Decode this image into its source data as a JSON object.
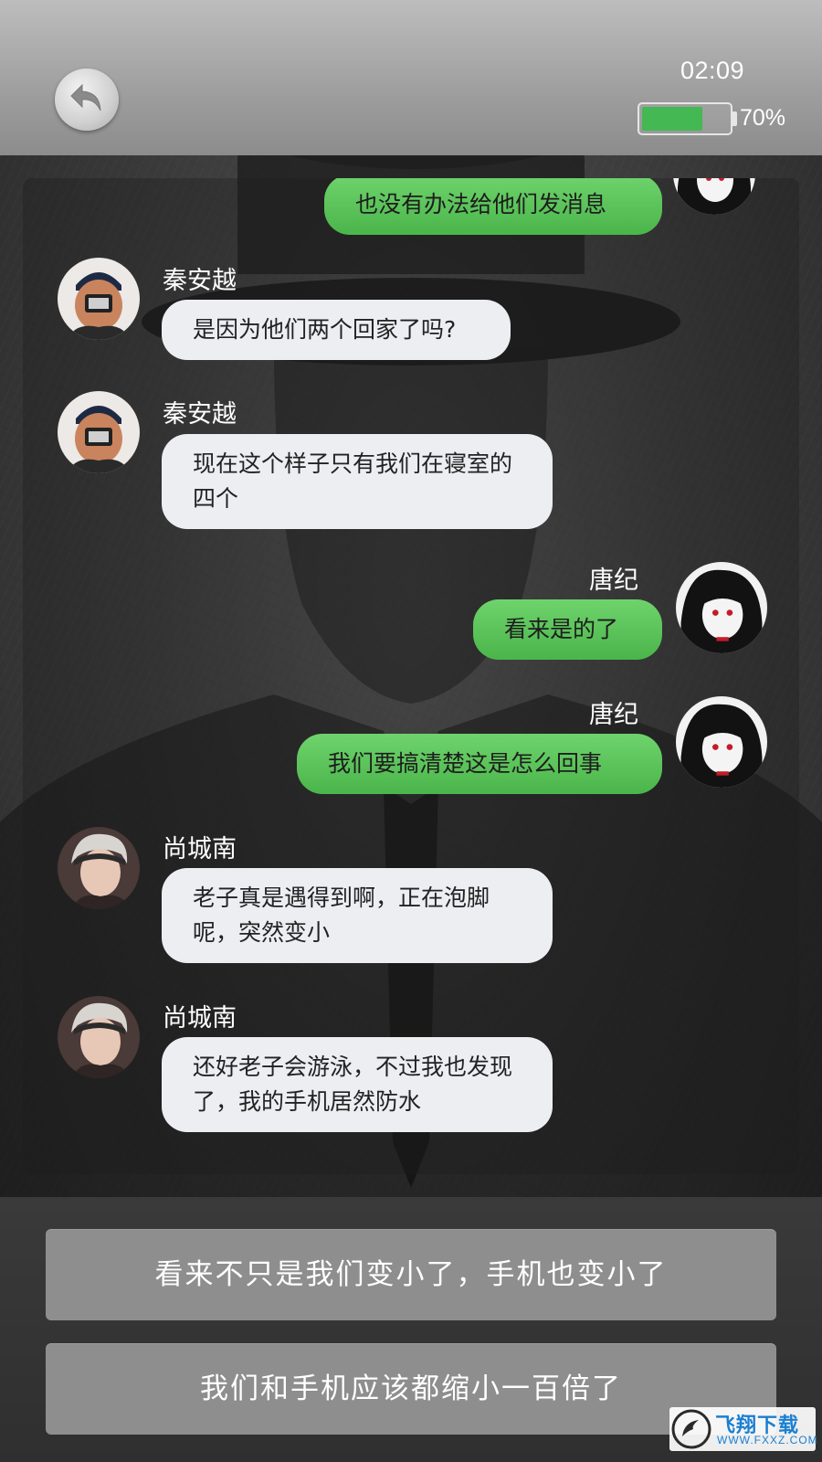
{
  "status_bar": {
    "time": "02:09",
    "battery_percent_label": "70%",
    "battery_level": 0.7,
    "battery_color": "#43b853"
  },
  "header": {
    "back_icon": "back-arrow-icon"
  },
  "messages": [
    {
      "side": "right",
      "sender": "唐纪",
      "text": "也没有办法给他们发消息"
    },
    {
      "side": "left",
      "sender": "秦安越",
      "text": "是因为他们两个回家了吗?"
    },
    {
      "side": "left",
      "sender": "秦安越",
      "text": "现在这个样子只有我们在寝室的四个"
    },
    {
      "side": "right",
      "sender": "唐纪",
      "text": "看来是的了"
    },
    {
      "side": "right",
      "sender": "唐纪",
      "text": "我们要搞清楚这是怎么回事"
    },
    {
      "side": "left",
      "sender": "尚城南",
      "text": "老子真是遇得到啊，正在泡脚呢，突然变小"
    },
    {
      "side": "left",
      "sender": "尚城南",
      "text": "还好老子会游泳，不过我也发现了，我的手机居然防水"
    }
  ],
  "options": [
    {
      "label": "看来不只是我们变小了，手机也变小了"
    },
    {
      "label": "我们和手机应该都缩小一百倍了"
    }
  ],
  "watermark": {
    "cn": "飞翔下载",
    "en": "WWW.FXXZ.COM"
  },
  "colors": {
    "sent_bubble": "#4ab54b",
    "received_bubble": "#eceef2",
    "option_button": "#8e8e8e"
  }
}
